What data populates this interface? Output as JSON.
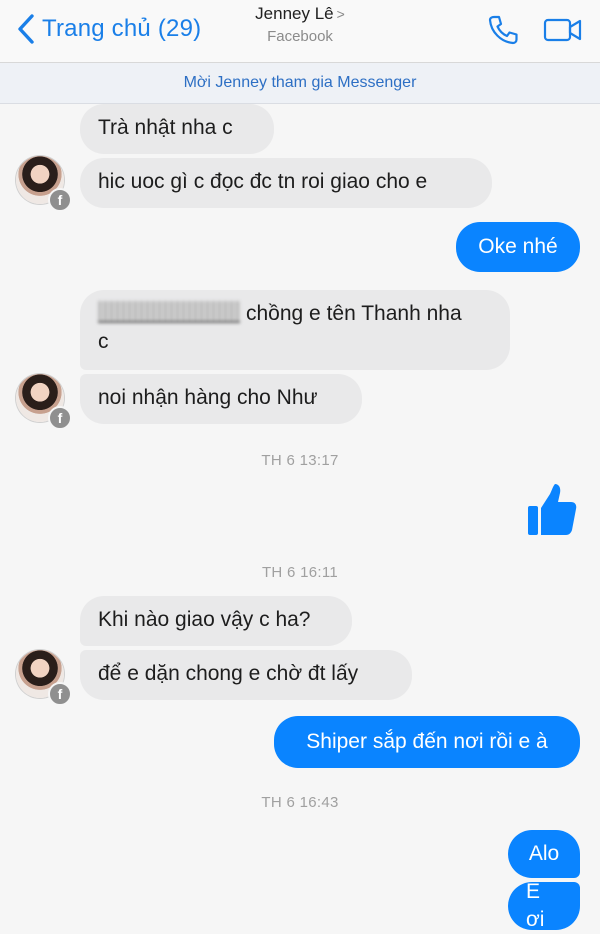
{
  "header": {
    "back_label": "Trang chủ (29)",
    "contact_name": "Jenney Lê",
    "name_chevron": ">",
    "subtitle": "Facebook"
  },
  "invite_bar": {
    "text": "Mời Jenney tham gia Messenger"
  },
  "messages": {
    "m1": "Trà nhật nha c",
    "m2": "hic uoc gì c đọc đc tn roi giao cho e",
    "m3": "Oke nhé",
    "m4_text": "chồng e tên Thanh nha",
    "m4_cont": "c",
    "m5": "noi nhận hàng cho Như",
    "m6": "Khi nào giao vậy c ha?",
    "m7": "để e dặn chong e chờ đt lấy",
    "m8": "Shiper sắp đến nơi rồi e à",
    "m9": "Alo",
    "m10": "E ơi"
  },
  "timestamps": [
    "TH 6 13:17",
    "TH 6 16:11",
    "TH 6 16:43"
  ],
  "icons": {
    "back": "chevron-left-icon",
    "call": "phone-icon",
    "video": "video-camera-icon",
    "like": "thumbs-up-icon",
    "badge": "facebook-badge-icon"
  },
  "colors": {
    "accent": "#0a84ff",
    "incoming_bubble": "#e9e9ea",
    "header_link": "#1a7fe8",
    "timestamp": "#a0a0a0"
  },
  "badge_letter": "f"
}
